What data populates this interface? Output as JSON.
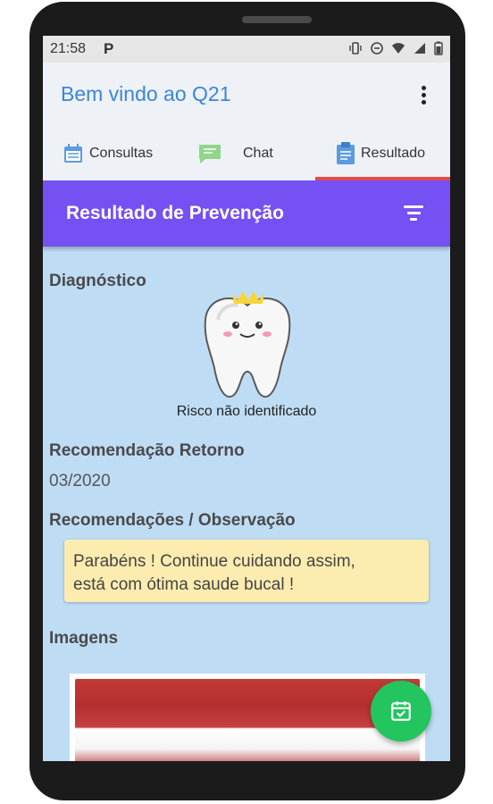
{
  "status_bar": {
    "time": "21:58",
    "app_glyph": "P"
  },
  "app_bar": {
    "title": "Bem vindo ao Q21"
  },
  "tabs": [
    {
      "label": "Consultas",
      "icon": "calendar-icon"
    },
    {
      "label": "Chat",
      "icon": "chat-icon"
    },
    {
      "label": "Resultado",
      "icon": "clipboard-icon"
    }
  ],
  "section_bar": {
    "title": "Resultado de Prevenção"
  },
  "diagnostico": {
    "label": "Diagnóstico",
    "risk_text": "Risco não identificado"
  },
  "retorno": {
    "label": "Recomendação Retorno",
    "value": "03/2020"
  },
  "observacao": {
    "label": "Recomendações / Observação",
    "line1": "Parabéns ! Continue cuidando assim,",
    "line2": "está com ótima saude bucal !"
  },
  "imagens": {
    "label": "Imagens"
  },
  "colors": {
    "accent_blue": "#3a86d9",
    "purple": "#7550f2",
    "fab_green": "#22c55e",
    "note_yellow": "#fdecb0",
    "tab_indicator": "#e64a4a"
  }
}
